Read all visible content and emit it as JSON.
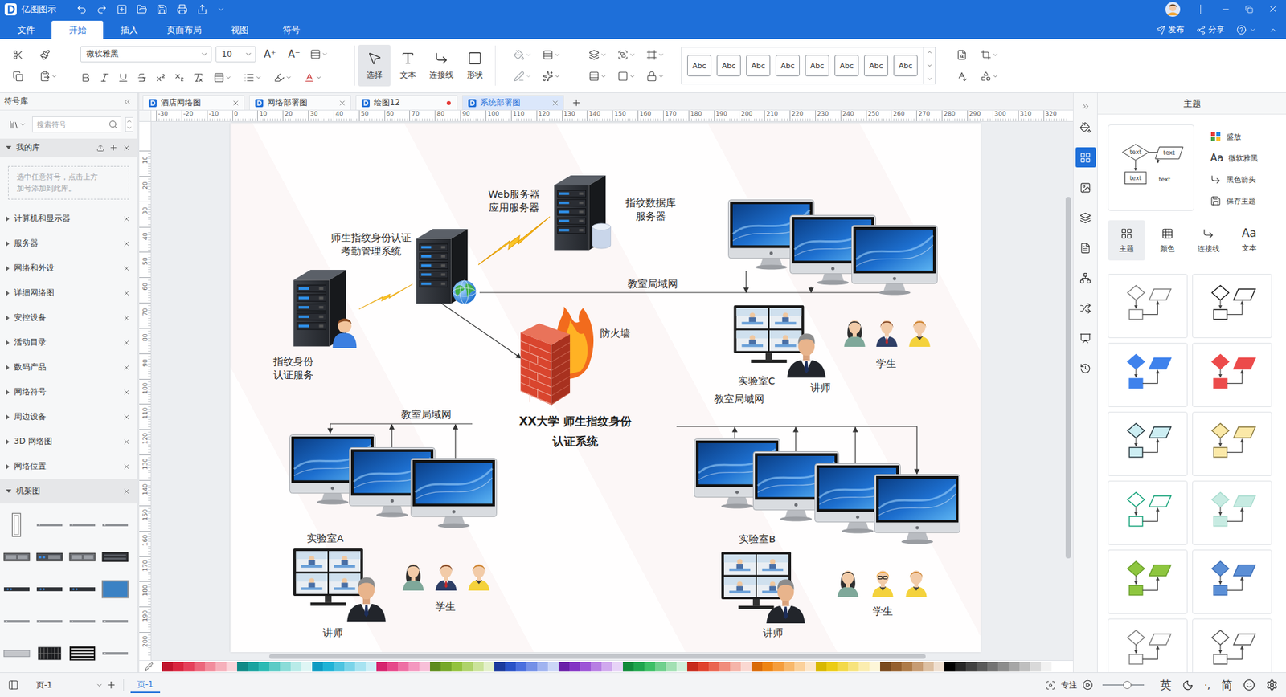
{
  "titleBar": {
    "appName": "亿图图示"
  },
  "menu": {
    "items": [
      {
        "label": "文件",
        "selected": false
      },
      {
        "label": "开始",
        "selected": true
      },
      {
        "label": "插入",
        "selected": false
      },
      {
        "label": "页面布局",
        "selected": false
      },
      {
        "label": "视图",
        "selected": false
      },
      {
        "label": "符号",
        "selected": false
      }
    ],
    "publish": "发布",
    "share": "分享"
  },
  "ribbon": {
    "font": "微软雅黑",
    "size": "10",
    "growFont": "A⁺",
    "shrinkFont": "A⁻",
    "tools": [
      {
        "label": "选择",
        "selected": true
      },
      {
        "label": "文本",
        "selected": false
      },
      {
        "label": "连接线",
        "selected": false
      },
      {
        "label": "形状",
        "selected": false
      }
    ],
    "styles": [
      "Abc",
      "Abc",
      "Abc",
      "Abc",
      "Abc",
      "Abc",
      "Abc",
      "Abc"
    ]
  },
  "library": {
    "title": "符号库",
    "search": {
      "placeholder": "搜索符号"
    },
    "myLibrary": {
      "label": "我的库",
      "expanded": true,
      "hint": "选中任意符号，点击上方\n加号添加到此库。"
    },
    "categories": [
      {
        "label": "计算机和显示器",
        "expanded": false
      },
      {
        "label": "服务器",
        "expanded": false
      },
      {
        "label": "网络和外设",
        "expanded": false
      },
      {
        "label": "详细网络图",
        "expanded": false
      },
      {
        "label": "安控设备",
        "expanded": false
      },
      {
        "label": "活动目录",
        "expanded": false
      },
      {
        "label": "数码产品",
        "expanded": false
      },
      {
        "label": "网络符号",
        "expanded": false
      },
      {
        "label": "周边设备",
        "expanded": false
      },
      {
        "label": "3D 网络图",
        "expanded": false
      },
      {
        "label": "网络位置",
        "expanded": false
      },
      {
        "label": "机架图",
        "expanded": true
      }
    ],
    "rackShapes": [
      {
        "kind": "tower"
      },
      {
        "kind": "thin"
      },
      {
        "kind": "thin"
      },
      {
        "kind": "thin"
      },
      {
        "kind": "unit"
      },
      {
        "kind": "unitBlue"
      },
      {
        "kind": "unit"
      },
      {
        "kind": "unitDark"
      },
      {
        "kind": "thinDark"
      },
      {
        "kind": "thinDark"
      },
      {
        "kind": "thinDark"
      },
      {
        "kind": "screen"
      },
      {
        "kind": "thin"
      },
      {
        "kind": "thin"
      },
      {
        "kind": "thin"
      },
      {
        "kind": "thin"
      },
      {
        "kind": "bar"
      },
      {
        "kind": "grid"
      },
      {
        "kind": "stripe"
      },
      {
        "kind": "thin"
      }
    ]
  },
  "docTabs": [
    {
      "label": "酒店网络图",
      "selected": false,
      "modified": false
    },
    {
      "label": "网络部署图",
      "selected": false,
      "modified": false
    },
    {
      "label": "绘图12",
      "selected": false,
      "modified": true
    },
    {
      "label": "系统部署图",
      "selected": true,
      "modified": false
    }
  ],
  "rulers": {
    "horizontal": [
      "-30",
      "-20",
      "-10",
      "0",
      "10",
      "20",
      "30",
      "40",
      "50",
      "60",
      "70",
      "80",
      "90",
      "100",
      "110",
      "120",
      "130",
      "140",
      "150",
      "160",
      "170",
      "180",
      "190",
      "200",
      "210",
      "220",
      "230",
      "240",
      "250",
      "260",
      "270",
      "280",
      "290",
      "300",
      "310",
      "320"
    ],
    "vertical": [
      "10",
      "20",
      "30",
      "40",
      "50",
      "60",
      "70",
      "80",
      "90",
      "100",
      "110",
      "120",
      "130",
      "140",
      "150",
      "160",
      "170",
      "180",
      "190",
      "200"
    ]
  },
  "diagram": {
    "shapes": [
      {
        "kind": "server-user"
      },
      {
        "kind": "bolt"
      },
      {
        "kind": "server-globe"
      },
      {
        "kind": "bolt-steep"
      },
      {
        "kind": "server-db"
      },
      {
        "kind": "imac"
      },
      {
        "kind": "imac"
      },
      {
        "kind": "imac"
      },
      {
        "kind": "firewall"
      },
      {
        "kind": "video"
      },
      {
        "kind": "lecturer"
      },
      {
        "kind": "student-f"
      },
      {
        "kind": "student-m"
      },
      {
        "kind": "student-y"
      },
      {
        "kind": "imac"
      },
      {
        "kind": "imac"
      },
      {
        "kind": "imac"
      },
      {
        "kind": "video"
      },
      {
        "kind": "lecturer"
      },
      {
        "kind": "student-f"
      },
      {
        "kind": "student-m"
      },
      {
        "kind": "student-y"
      },
      {
        "kind": "imac"
      },
      {
        "kind": "imac"
      },
      {
        "kind": "imac"
      },
      {
        "kind": "imac"
      },
      {
        "kind": "video"
      },
      {
        "kind": "lecturer"
      },
      {
        "kind": "student-f"
      },
      {
        "kind": "student-g"
      },
      {
        "kind": "student-y"
      }
    ],
    "labels": [
      {
        "text": "指纹身份\n认证服务",
        "kind": "label"
      },
      {
        "text": "师生指纹身份认证\n考勤管理系统",
        "kind": "label"
      },
      {
        "text": "Web服务器\n应用服务器",
        "kind": "label"
      },
      {
        "text": "指纹数据库\n服务器",
        "kind": "label"
      },
      {
        "text": "教室局域网",
        "kind": "label"
      },
      {
        "text": "防火墙",
        "kind": "label"
      },
      {
        "text": "XX大学 师生指纹身份\n认证系统",
        "kind": "title"
      },
      {
        "text": "实验室C",
        "kind": "label"
      },
      {
        "text": "讲师",
        "kind": "label"
      },
      {
        "text": "学生",
        "kind": "label"
      },
      {
        "text": "教室局域网",
        "kind": "label"
      },
      {
        "text": "教室局域网",
        "kind": "label"
      },
      {
        "text": "实验室A",
        "kind": "label"
      },
      {
        "text": "学生",
        "kind": "label"
      },
      {
        "text": "讲师",
        "kind": "label"
      },
      {
        "text": "实验室B",
        "kind": "label"
      },
      {
        "text": "学生",
        "kind": "label"
      },
      {
        "text": "讲师",
        "kind": "label"
      }
    ]
  },
  "palette": [
    "#c0142c",
    "#d9263f",
    "#e5405a",
    "#ec667b",
    "#f28c9c",
    "#f6b0bb",
    "#fad4da",
    "#0f8a87",
    "#18a39f",
    "#2bbab4",
    "#5ccbc6",
    "#8bdcd8",
    "#b8ebe8",
    "#dff6f5",
    "#0e9bc2",
    "#1fb3d6",
    "#4cc4e0",
    "#7ad4e9",
    "#a7e3f1",
    "#cdeff7",
    "#d6246e",
    "#e6478a",
    "#ee6fa4",
    "#f497bf",
    "#f8bfd8",
    "#5e8c1d",
    "#76a82a",
    "#93c23e",
    "#afd36a",
    "#cbe39a",
    "#e3f0c9",
    "#1b3a9c",
    "#2952c7",
    "#4a6fde",
    "#7490e7",
    "#a0b3f0",
    "#cbd6f7",
    "#6a1fa8",
    "#8333c4",
    "#9d55d6",
    "#b77ee3",
    "#d0a8ee",
    "#e7d3f7",
    "#118a3b",
    "#1fa54d",
    "#3dbf66",
    "#6fd08d",
    "#a2e0b3",
    "#d0f0da",
    "#c72a1c",
    "#e0412d",
    "#ea6450",
    "#f08c7c",
    "#f5b4a9",
    "#fad8d2",
    "#d96a08",
    "#ee8413",
    "#f59d3c",
    "#f8b86b",
    "#fbd19b",
    "#fde7cb",
    "#d8b800",
    "#eccc14",
    "#f3d948",
    "#f7e37c",
    "#fbedaf",
    "#fdf6d8",
    "#7a4a1e",
    "#95602e",
    "#ae7b48",
    "#c79c73",
    "#ddc0a3",
    "#efdfd0",
    "#000000",
    "#262626",
    "#404040",
    "#595959",
    "#737373",
    "#8c8c8c",
    "#a6a6a6",
    "#bfbfbf",
    "#d9d9d9",
    "#f2f2f2",
    "#ffffff"
  ],
  "rightRail": [
    {
      "selected": false
    },
    {
      "selected": true
    },
    {
      "selected": false
    },
    {
      "selected": false
    },
    {
      "selected": false
    },
    {
      "selected": false
    },
    {
      "selected": false
    },
    {
      "selected": false
    },
    {
      "selected": false
    }
  ],
  "themePanel": {
    "title": "主题",
    "previewTexts": [
      "text",
      "text",
      "text",
      "text"
    ],
    "fontIcon": "Aa",
    "options": [
      "盛放",
      "微软雅黑",
      "黑色箭头",
      "保存主题"
    ],
    "tabs": [
      {
        "label": "主题",
        "selected": true
      },
      {
        "label": "颜色",
        "selected": false
      },
      {
        "label": "连接线",
        "selected": false
      },
      {
        "label": "文本",
        "selected": false
      }
    ],
    "themes": [
      {
        "color": "#ffffff",
        "line": "#7f7f7f"
      },
      {
        "color": "#ffffff",
        "line": "#1a1a1a"
      },
      {
        "color": "#3f82ec",
        "line": "#3f82ec"
      },
      {
        "color": "#ec4b4b",
        "line": "#ec4b4b"
      },
      {
        "color": "#cdeef3",
        "line": "#2a3a40"
      },
      {
        "color": "#fbe9a8",
        "line": "#8a7a40"
      },
      {
        "color": "#ffffff",
        "line": "#16a37a"
      },
      {
        "color": "#c7ebe2",
        "line": "#a9dccf"
      },
      {
        "color": "#8ec63f",
        "line": "#6aa02a"
      },
      {
        "color": "#5b8fd6",
        "line": "#3d6fb8"
      },
      {
        "color": "#ffffff",
        "line": "#7f7f7f"
      },
      {
        "color": "#ffffff",
        "line": "#555555"
      }
    ]
  },
  "statusBar": {
    "pageSelect": "页-1",
    "pages": [
      {
        "label": "页-1",
        "selected": true
      }
    ],
    "focus": "专注",
    "zoom": {
      "level": 0.6
    },
    "ime": [
      "英",
      "·,",
      "简"
    ]
  }
}
